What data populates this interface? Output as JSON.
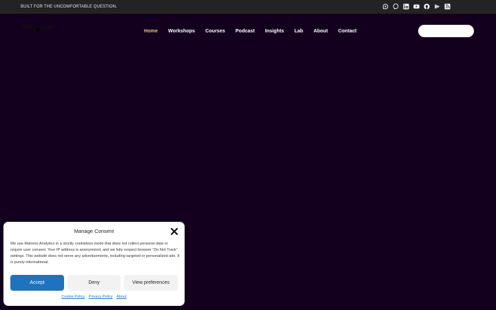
{
  "topbar": {
    "tagline": "BUILT FOR THE UNCOMFORTABLE QUESTION.",
    "social_icons": [
      "whatsapp-icon",
      "chat-icon",
      "linkedin-icon",
      "youtube-icon",
      "github-icon",
      "google-play-icon",
      "rss-icon"
    ]
  },
  "nav": {
    "items": [
      {
        "label": "Home",
        "active": true
      },
      {
        "label": "Workshops"
      },
      {
        "label": "Courses"
      },
      {
        "label": "Podcast"
      },
      {
        "label": "Insights"
      },
      {
        "label": "Lab"
      },
      {
        "label": "About"
      },
      {
        "label": "Contact"
      }
    ]
  },
  "consent": {
    "title": "Manage Consent",
    "body": "We use Matomo Analytics in a strictly cookieless mode that does not collect personal data or require user consent. Your IP address is anonymized, and we fully respect browser “Do Not Track” settings. This website does not serve any advertisements, including targeted or personalized ads. It is purely informational.",
    "accept_label": "Accept",
    "deny_label": "Deny",
    "prefs_label": "View preferences",
    "links": [
      "Cookie Policy",
      "Privacy Policy",
      "About"
    ]
  },
  "colors": {
    "background": "#13001f",
    "topbar": "#232323",
    "nav_active": "#f0c06a",
    "accept": "#1e73be"
  }
}
